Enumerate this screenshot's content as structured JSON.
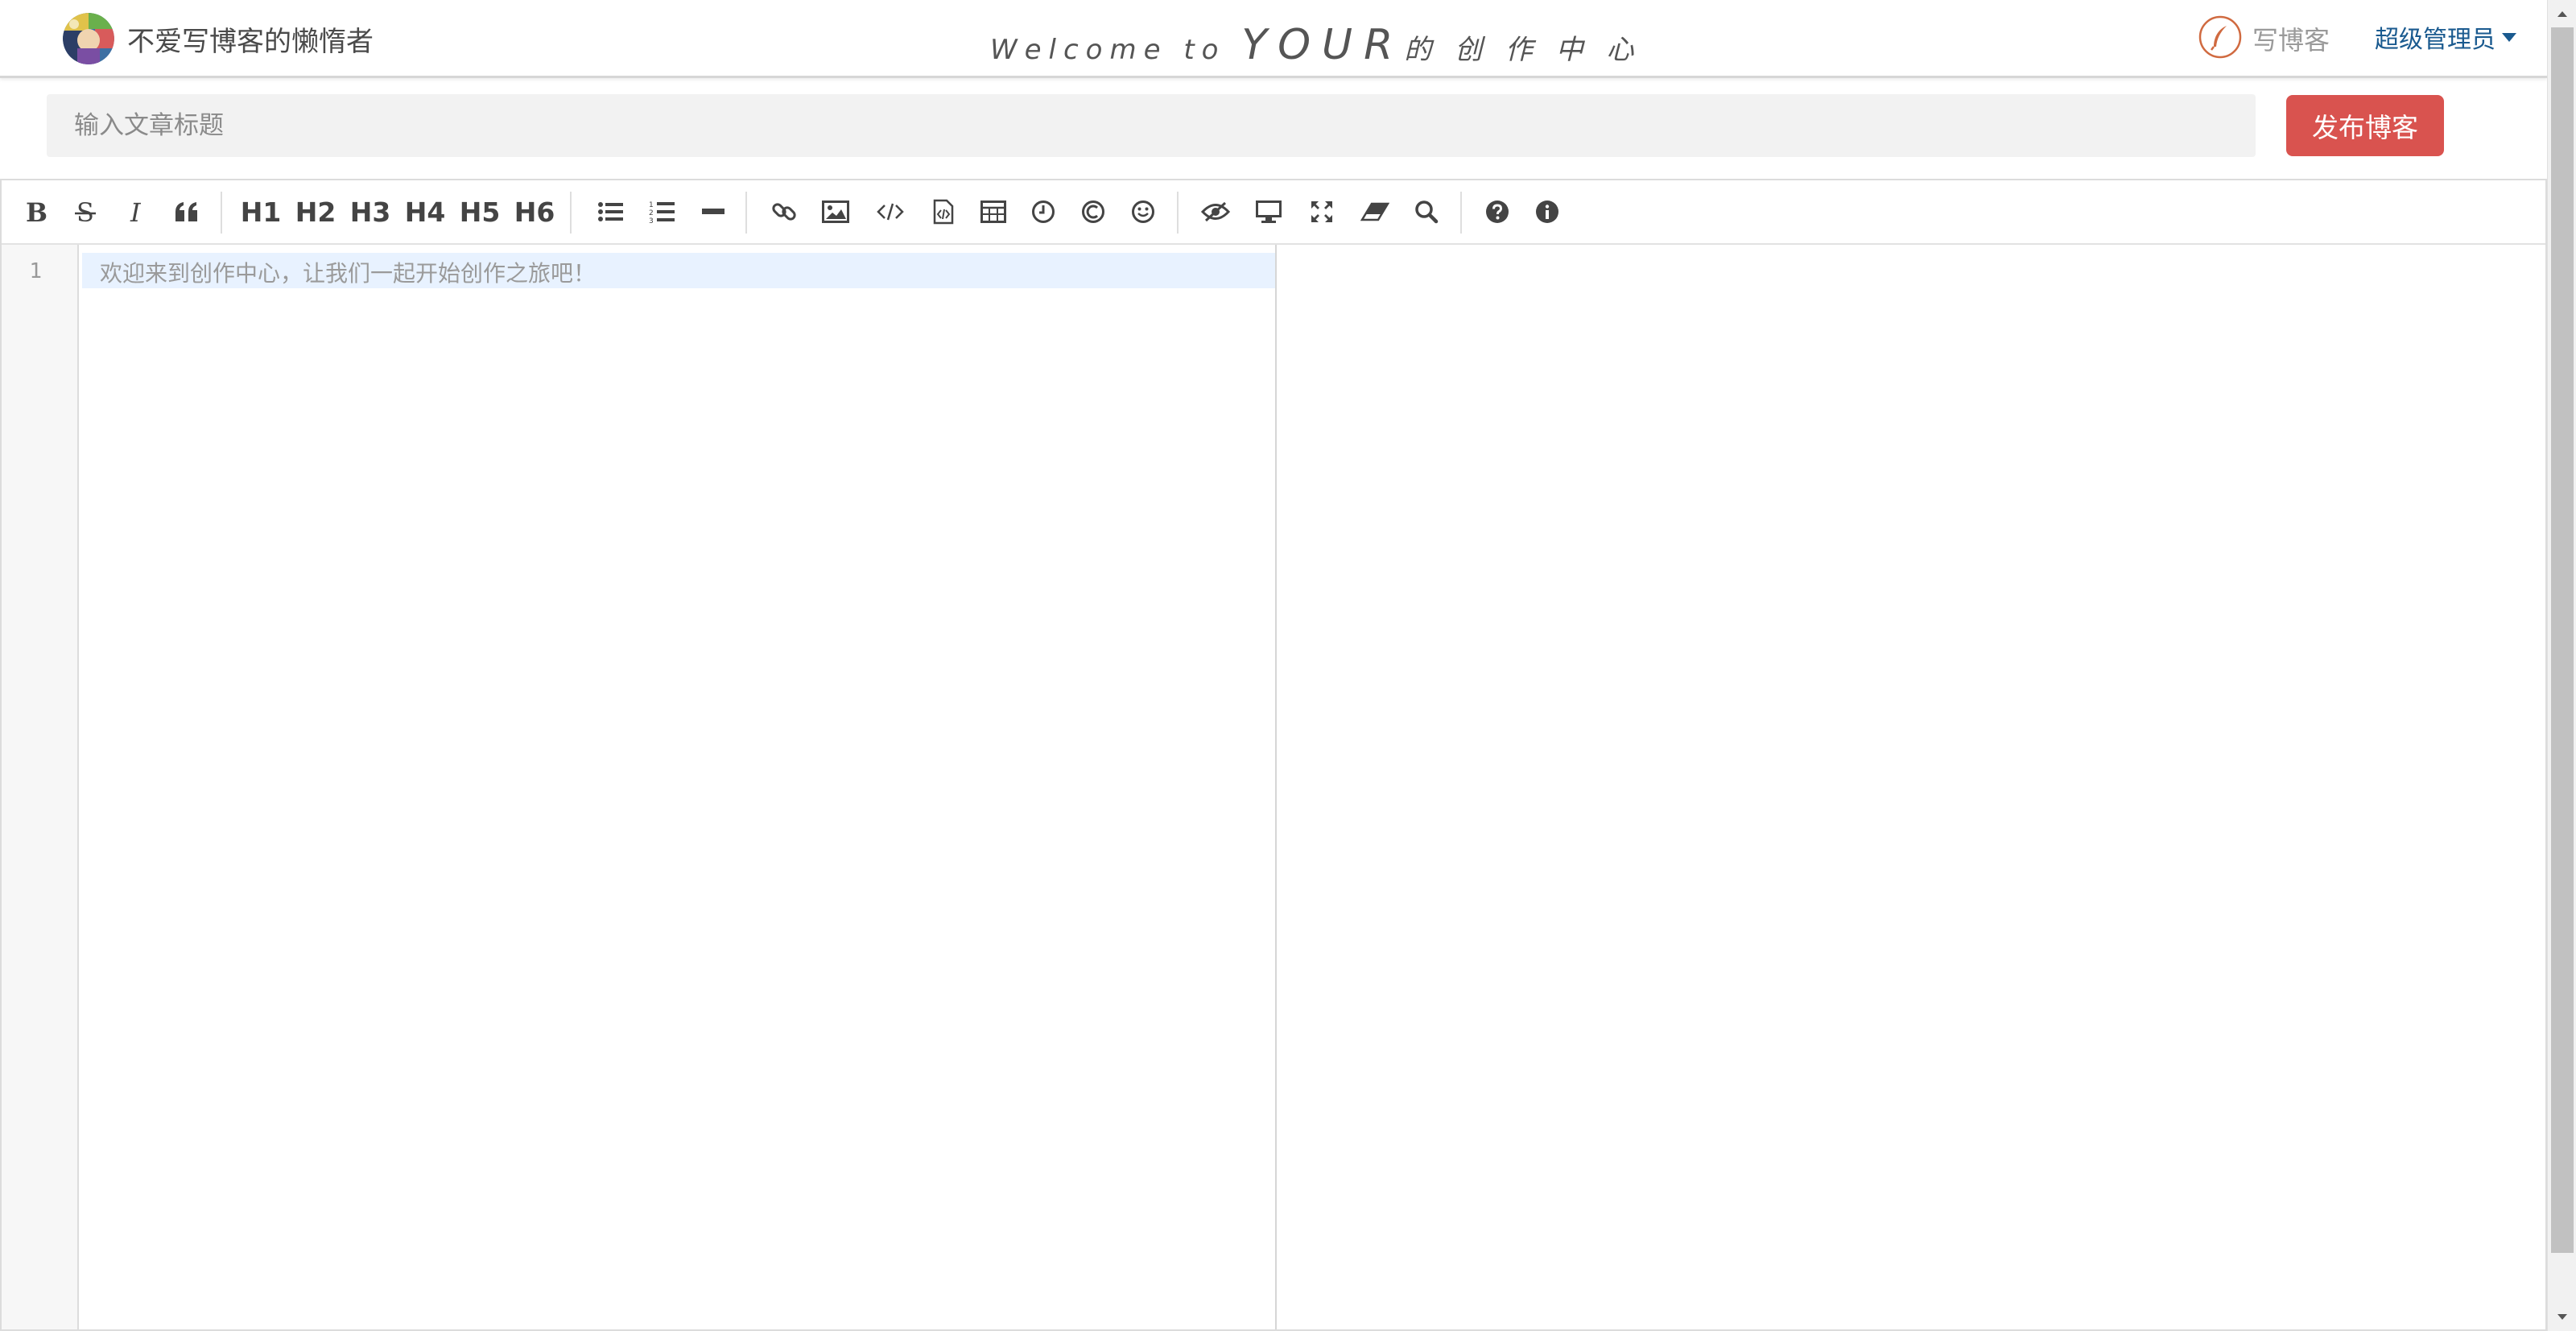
{
  "navbar": {
    "brand_name": "不爱写博客的懒惰者",
    "welcome_prefix": "Welcome to",
    "welcome_big": "YOUR",
    "welcome_suffix": "的 创 作 中 心",
    "write_label": "写博客",
    "user_label": "超级管理员"
  },
  "title_bar": {
    "title_placeholder": "输入文章标题",
    "publish_label": "发布博客"
  },
  "toolbar": {
    "headings": [
      "H1",
      "H2",
      "H3",
      "H4",
      "H5",
      "H6"
    ],
    "icons": [
      "bold-icon",
      "strikethrough-icon",
      "italic-icon",
      "quote-icon",
      "h1",
      "h2",
      "h3",
      "h4",
      "h5",
      "h6",
      "list-ul-icon",
      "list-ol-icon",
      "hr-icon",
      "link-icon",
      "image-icon",
      "code-icon",
      "code-block-icon",
      "table-icon",
      "clock-icon",
      "copyright-icon",
      "emoji-icon",
      "watch-icon",
      "preview-icon",
      "fullscreen-icon",
      "clear-icon",
      "search-icon",
      "help-icon",
      "info-icon"
    ]
  },
  "editor": {
    "line_number": "1",
    "placeholder": "欢迎来到创作中心，让我们一起开始创作之旅吧！"
  },
  "colors": {
    "publish_button": "#d9534f",
    "user_link": "#1a5a8f",
    "active_line": "#e8f2ff"
  }
}
